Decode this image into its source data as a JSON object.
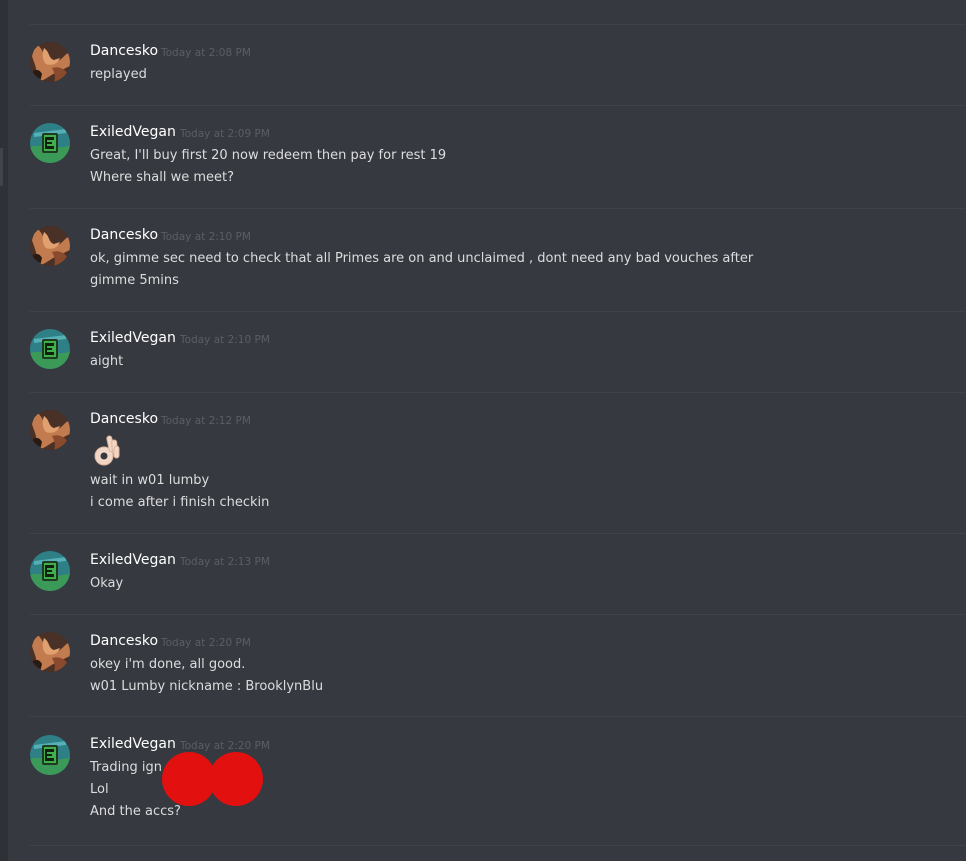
{
  "messages": [
    {
      "author": "Dancesko",
      "time": "Today at 2:08 PM",
      "lines": [
        "replayed"
      ]
    },
    {
      "author": "ExiledVegan",
      "time": "Today at 2:09 PM",
      "lines": [
        "Great, I'll buy first 20 now redeem then pay for rest 19",
        "Where shall we meet?"
      ]
    },
    {
      "author": "Dancesko",
      "time": "Today at 2:10 PM",
      "lines": [
        "ok, gimme sec need to check that all Primes are on and unclaimed , dont need any bad vouches after",
        "gimme 5mins"
      ]
    },
    {
      "author": "ExiledVegan",
      "time": "Today at 2:10 PM",
      "lines": [
        "aight"
      ]
    },
    {
      "author": "Dancesko",
      "time": "Today at 2:12 PM",
      "emoji": "ok-hand-emoji",
      "lines": [
        "wait in w01 lumby",
        "i come after i finish checkin"
      ]
    },
    {
      "author": "ExiledVegan",
      "time": "Today at 2:13 PM",
      "lines": [
        "Okay"
      ]
    },
    {
      "author": "Dancesko",
      "time": "Today at 2:20 PM",
      "lines": [
        "okey i'm done, all good.",
        "w01 Lumby nickname : BrooklynBlu"
      ]
    },
    {
      "author": "ExiledVegan",
      "time": "Today at 2:20 PM",
      "lines": [
        "Trading ign",
        "Lol",
        "And the accs?"
      ]
    }
  ],
  "colors": {
    "background": "#36393f",
    "username": "#ffffff",
    "message_text": "#dcddde",
    "timestamp": "#5b5e63",
    "redaction": "#e2110f"
  },
  "icons": {
    "dancesko_avatar": "dancer-avatar-icon",
    "exiledvegan_avatar": "green-badge-avatar-icon",
    "reaction": "ok-hand-emoji"
  }
}
